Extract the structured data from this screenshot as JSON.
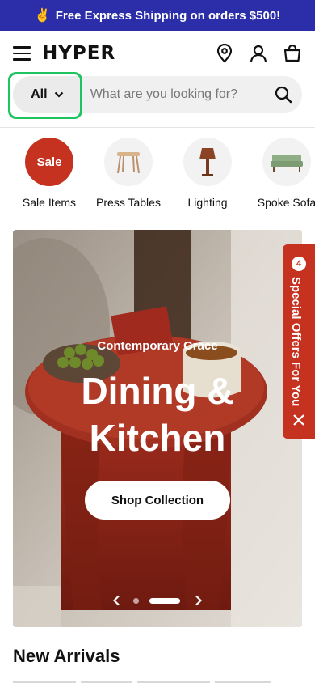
{
  "promo": {
    "emoji": "✌️",
    "text": "Free Express Shipping on orders $500!"
  },
  "header": {
    "logo": "HYPER",
    "icons": [
      "menu-icon",
      "location-pin-icon",
      "account-icon",
      "shopping-bag-icon"
    ]
  },
  "search": {
    "category": "All",
    "placeholder": "What are you looking for?"
  },
  "categories": [
    {
      "label": "Sale Items",
      "badge": "Sale"
    },
    {
      "label": "Press Tables"
    },
    {
      "label": "Lighting"
    },
    {
      "label": "Spoke Sofa"
    }
  ],
  "hero": {
    "eyebrow": "Contemporary Grace",
    "headline_line1": "Dining &",
    "headline_line2": "Kitchen",
    "cta": "Shop Collection",
    "slides_total": 2,
    "active_slide": 2
  },
  "offers": {
    "count": "4",
    "label": "Special Offers For You"
  },
  "section": {
    "title": "New Arrivals"
  },
  "colors": {
    "promo": "#2b2ea8",
    "accent_red": "#c53220",
    "focus_green": "#1fc45e"
  }
}
